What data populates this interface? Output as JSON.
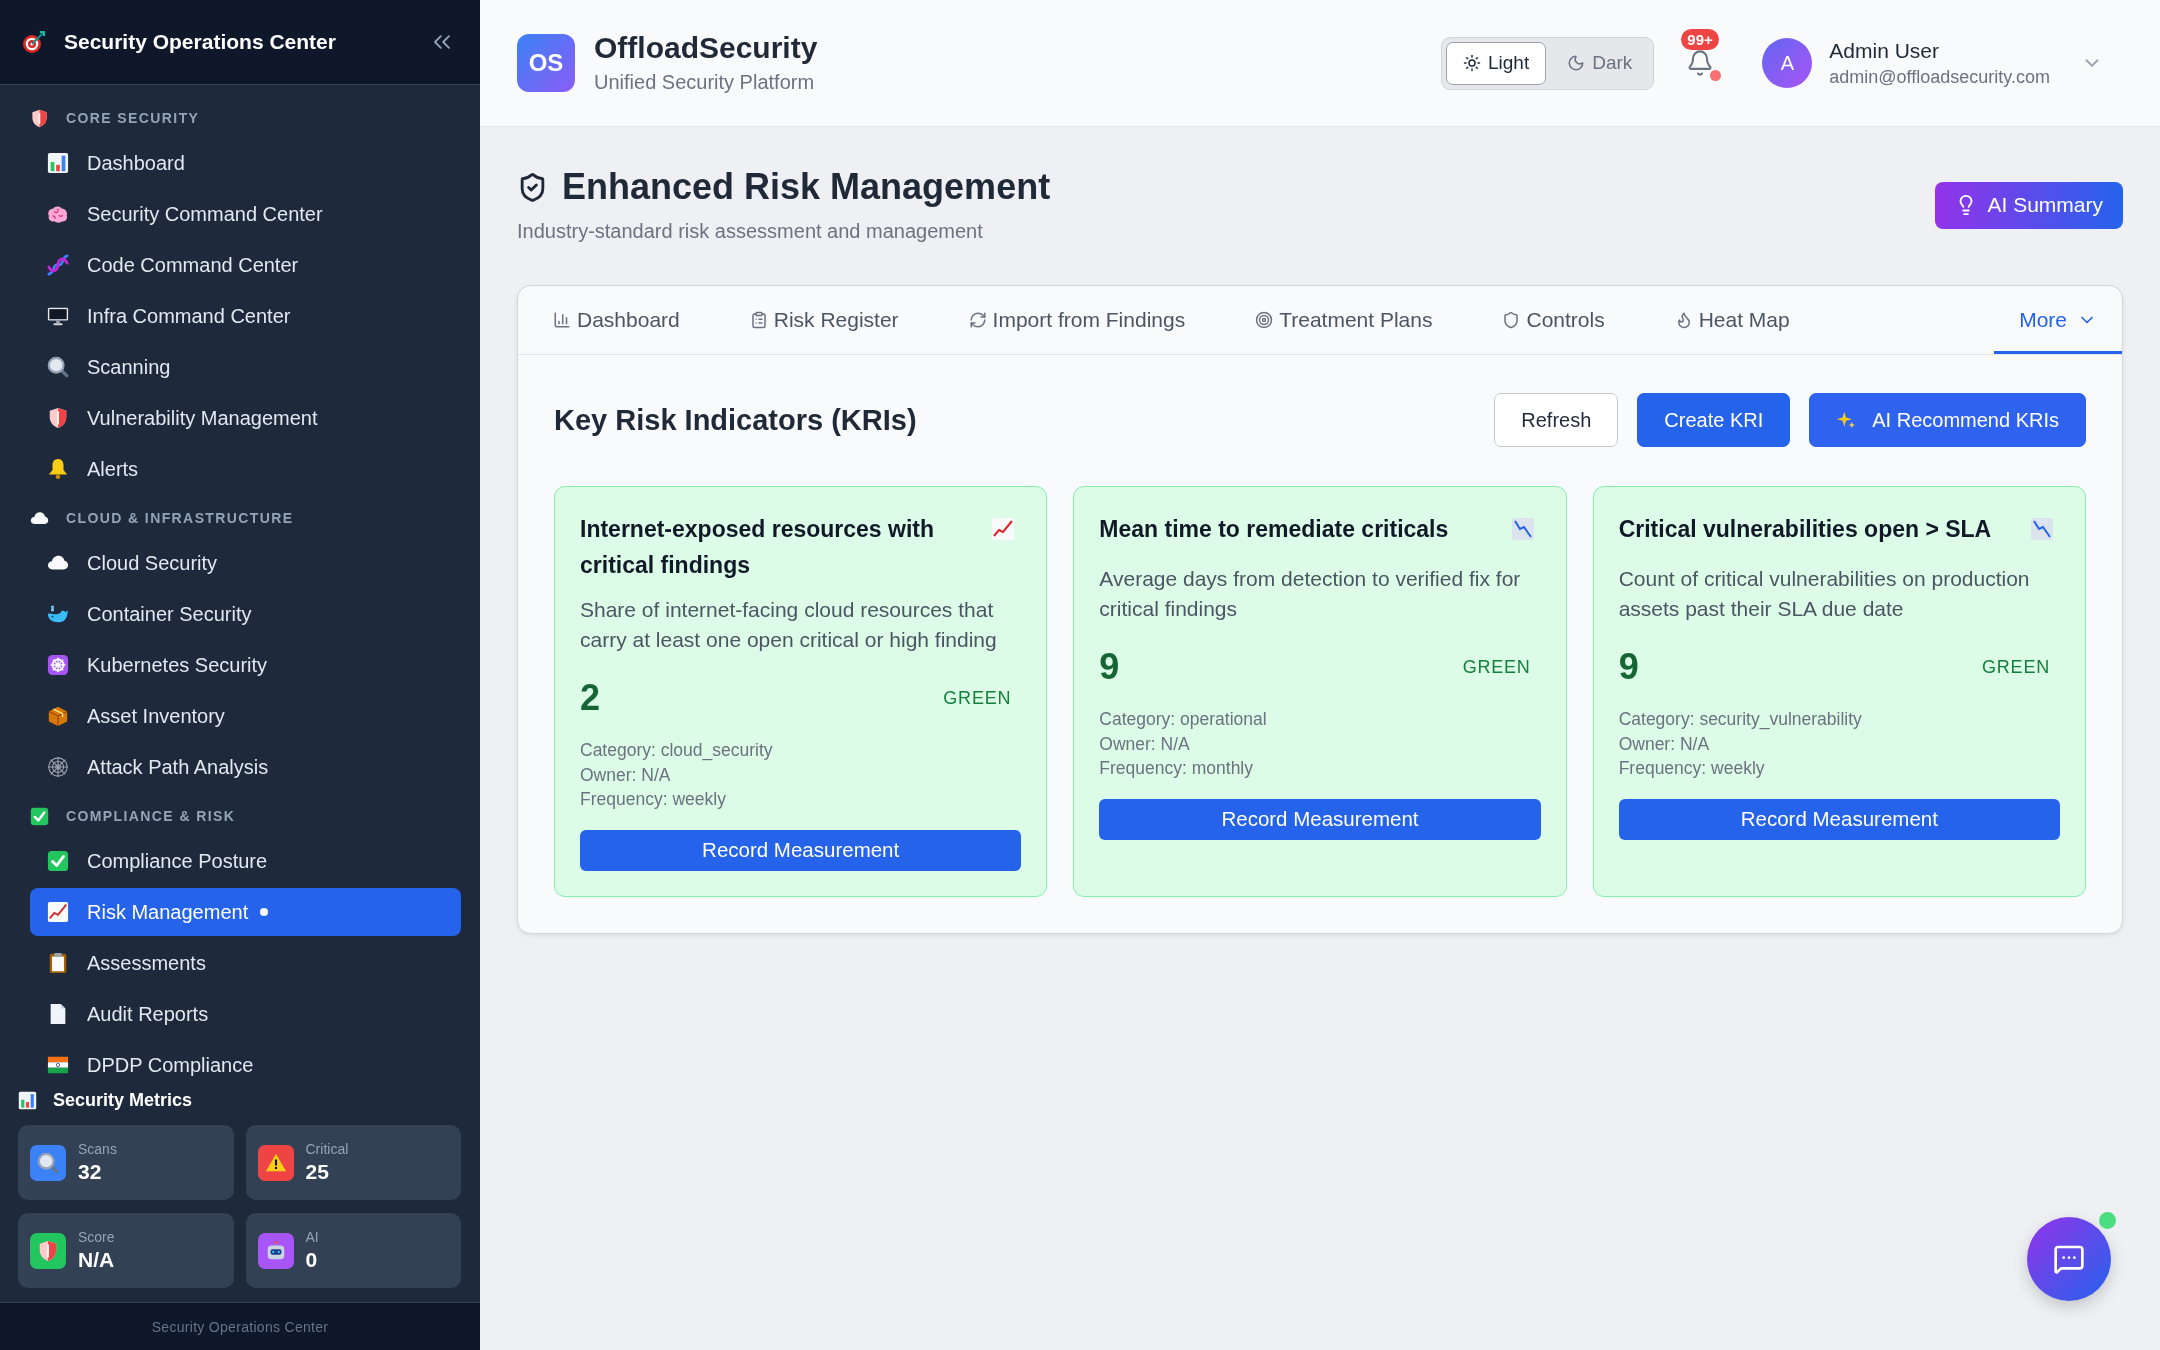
{
  "sidebar": {
    "title": "Security Operations Center",
    "sections": [
      {
        "title": "CORE SECURITY",
        "items": [
          {
            "label": "Dashboard",
            "selected": false
          },
          {
            "label": "Security Command Center",
            "selected": false
          },
          {
            "label": "Code Command Center",
            "selected": false
          },
          {
            "label": "Infra Command Center",
            "selected": false
          },
          {
            "label": "Scanning",
            "selected": false
          },
          {
            "label": "Vulnerability Management",
            "selected": false
          },
          {
            "label": "Alerts",
            "selected": false
          }
        ]
      },
      {
        "title": "CLOUD & INFRASTRUCTURE",
        "items": [
          {
            "label": "Cloud Security",
            "selected": false
          },
          {
            "label": "Container Security",
            "selected": false
          },
          {
            "label": "Kubernetes Security",
            "selected": false
          },
          {
            "label": "Asset Inventory",
            "selected": false
          },
          {
            "label": "Attack Path Analysis",
            "selected": false
          }
        ]
      },
      {
        "title": "COMPLIANCE & RISK",
        "items": [
          {
            "label": "Compliance Posture",
            "selected": false
          },
          {
            "label": "Risk Management",
            "selected": true
          },
          {
            "label": "Assessments",
            "selected": false
          },
          {
            "label": "Audit Reports",
            "selected": false
          },
          {
            "label": "DPDP Compliance",
            "selected": false
          }
        ]
      }
    ],
    "metrics": {
      "title": "Security Metrics",
      "items": [
        {
          "label": "Scans",
          "value": "32",
          "color": "#3b82f6"
        },
        {
          "label": "Critical",
          "value": "25",
          "color": "#ef4444"
        },
        {
          "label": "Score",
          "value": "N/A",
          "color": "#22c55e"
        },
        {
          "label": "AI",
          "value": "0",
          "color": "#a855f7"
        }
      ]
    },
    "footer": "Security Operations Center"
  },
  "header": {
    "logo": "OS",
    "brand": "OffloadSecurity",
    "tagline": "Unified Security Platform",
    "theme_options": [
      {
        "label": "Light",
        "selected": true
      },
      {
        "label": "Dark",
        "selected": false
      }
    ],
    "notifications_badge": "99+",
    "user": {
      "initial": "A",
      "name": "Admin User",
      "email": "admin@offloadsecurity.com"
    }
  },
  "page": {
    "title": "Enhanced Risk Management",
    "subtitle": "Industry-standard risk assessment and management",
    "action": "AI Summary"
  },
  "tabs": [
    {
      "label": "Dashboard",
      "kind": "page",
      "selected": false
    },
    {
      "label": "Risk Register",
      "kind": "page",
      "selected": false
    },
    {
      "label": "Import from Findings",
      "kind": "page",
      "selected": false
    },
    {
      "label": "Treatment Plans",
      "kind": "page",
      "selected": false
    },
    {
      "label": "Controls",
      "kind": "page",
      "selected": false
    },
    {
      "label": "Heat Map",
      "kind": "page",
      "selected": false
    },
    {
      "label": "More",
      "kind": "dropdown",
      "selected": true
    }
  ],
  "kri_section": {
    "title": "Key Risk Indicators (KRIs)",
    "buttons": [
      {
        "label": "Refresh",
        "kind": "outline"
      },
      {
        "label": "Create KRI",
        "kind": "primary"
      },
      {
        "label": "AI Recommend KRIs",
        "kind": "ai"
      }
    ],
    "cards": [
      {
        "kind": "rising",
        "title": "Internet-exposed resources with critical findings",
        "description": "Share of internet-facing cloud resources that carry at least one open critical or high finding",
        "value": "2",
        "status": "GREEN",
        "meta": [
          "Category: cloud_security",
          "Owner: N/A",
          "Frequency: weekly"
        ],
        "button": "Record Measurement"
      },
      {
        "kind": "falling",
        "title": "Mean time to remediate criticals",
        "description": "Average days from detection to verified fix for critical findings",
        "value": "9",
        "status": "GREEN",
        "meta": [
          "Category: operational",
          "Owner: N/A",
          "Frequency: monthly"
        ],
        "button": "Record Measurement"
      },
      {
        "kind": "falling",
        "title": "Critical vulnerabilities open > SLA",
        "description": "Count of critical vulnerabilities on production assets past their SLA due date",
        "value": "9",
        "status": "GREEN",
        "meta": [
          "Category: security_vulnerability",
          "Owner: N/A",
          "Frequency: weekly"
        ],
        "button": "Record Measurement"
      }
    ]
  }
}
